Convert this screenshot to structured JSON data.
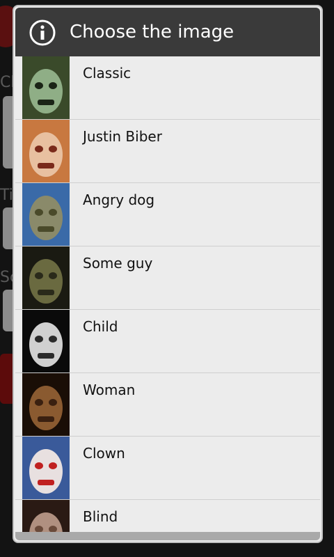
{
  "background": {
    "labels": [
      "Ch",
      "Ti",
      "Sc"
    ]
  },
  "dialog": {
    "title": "Choose the image",
    "header_icon": "info-icon",
    "items": [
      {
        "label": "Classic",
        "thumb_colors": [
          "#3a4a2a",
          "#8fae86",
          "#1a2416"
        ]
      },
      {
        "label": "Justin Biber",
        "thumb_colors": [
          "#c87840",
          "#e8c0a0",
          "#7a2a1a"
        ]
      },
      {
        "label": "Angry dog",
        "thumb_colors": [
          "#3a6aa8",
          "#8a8a6a",
          "#4a4a2a"
        ]
      },
      {
        "label": "Some guy",
        "thumb_colors": [
          "#1a1a12",
          "#6a6a40",
          "#2a2a1a"
        ]
      },
      {
        "label": "Child",
        "thumb_colors": [
          "#0a0a0a",
          "#d0d0d0",
          "#2a2a2a"
        ]
      },
      {
        "label": "Woman",
        "thumb_colors": [
          "#1a0e06",
          "#8a5a30",
          "#3a2010"
        ]
      },
      {
        "label": "Clown",
        "thumb_colors": [
          "#3a5a9a",
          "#e8e0e0",
          "#c02020"
        ]
      },
      {
        "label": "Blind",
        "thumb_colors": [
          "#2a1a14",
          "#b09080",
          "#6a4a3a"
        ]
      }
    ]
  }
}
